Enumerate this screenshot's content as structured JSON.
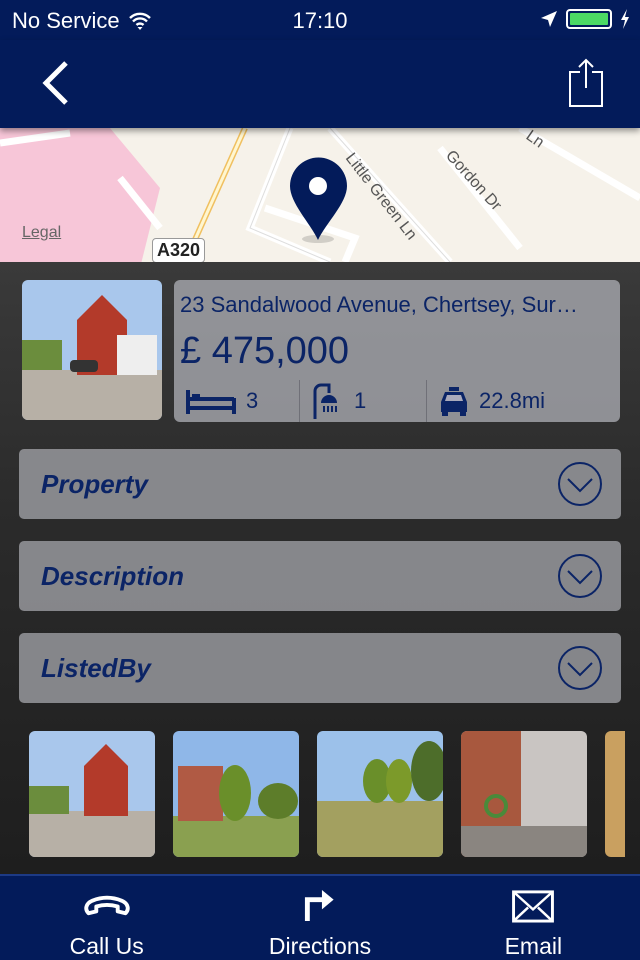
{
  "status": {
    "carrier": "No Service",
    "time": "17:10"
  },
  "map": {
    "legal": "Legal",
    "road_label": "A320",
    "streets": [
      "Little Green Ln",
      "Gordon Dr",
      "Ln"
    ]
  },
  "listing": {
    "address": "23 Sandalwood Avenue, Chertsey, Sur…",
    "price": "£ 475,000",
    "bedrooms": "3",
    "bathrooms": "1",
    "distance": "22.8mi"
  },
  "sections": [
    {
      "label": "Property"
    },
    {
      "label": "Description"
    },
    {
      "label": "ListedBy"
    }
  ],
  "tabbar": {
    "call": "Call Us",
    "directions": "Directions",
    "email": "Email"
  },
  "colors": {
    "navy": "#031b5a",
    "battery": "#4cd964"
  }
}
